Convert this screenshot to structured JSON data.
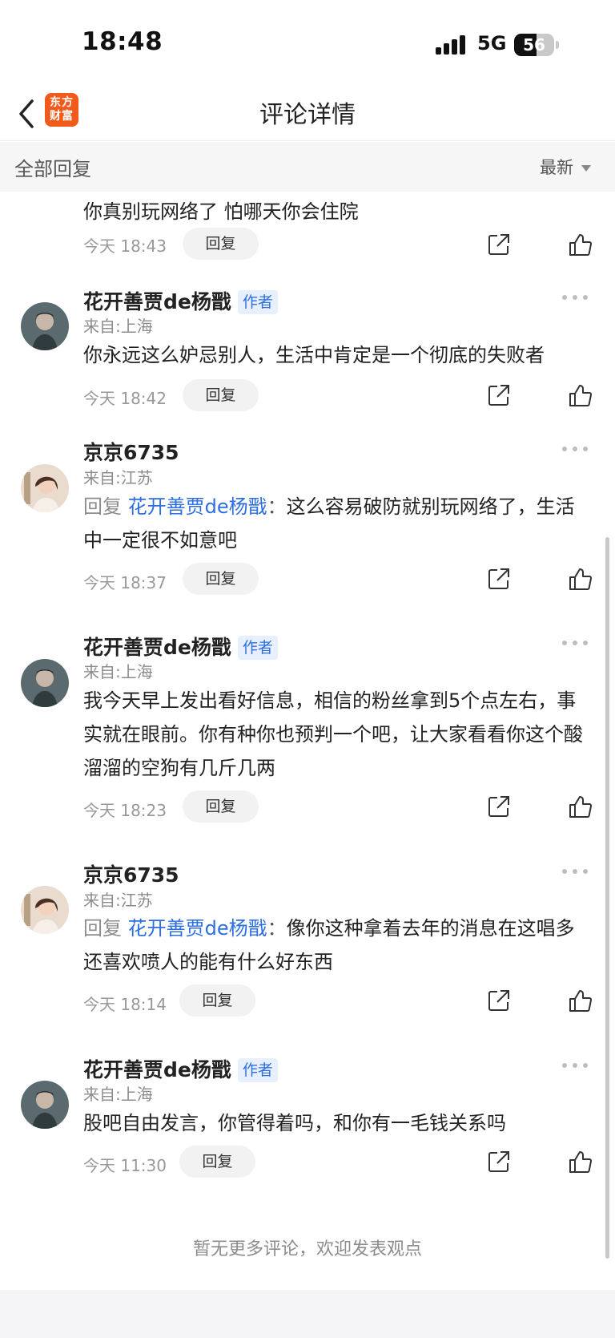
{
  "status_bar": {
    "time": "18:48",
    "network": "5G",
    "battery": "56",
    "battery_level": 0.56
  },
  "nav": {
    "logo_line1": "东方",
    "logo_line2": "财富",
    "title": "评论详情",
    "back_icon": "chevron-left-icon"
  },
  "section": {
    "title": "全部回复",
    "sort_label": "最新"
  },
  "reply_button_label": "回复",
  "reply_prefix": "回复",
  "reply_separator": "：",
  "author_badge": "作者",
  "partial_comment": {
    "text": "你真别玩网络了 怕哪天你会住院",
    "time": "今天 18:43"
  },
  "comments": [
    {
      "user": "花开善贾de杨戬",
      "is_author": true,
      "location": "来自:上海",
      "text": "你永远这么妒忌别人，生活中肯定是一个彻底的失败者",
      "time": "今天 18:42"
    },
    {
      "user": "京京6735",
      "is_author": false,
      "location": "来自:江苏",
      "reply_to": "花开善贾de杨戬",
      "text": "这么容易破防就别玩网络了，生活中一定很不如意吧",
      "time": "今天 18:37"
    },
    {
      "user": "花开善贾de杨戬",
      "is_author": true,
      "location": "来自:上海",
      "text": "我今天早上发出看好信息，相信的粉丝拿到5个点左右，事实就在眼前。你有种你也预判一个吧，让大家看看你这个酸溜溜的空狗有几斤几两",
      "time": "今天 18:23"
    },
    {
      "user": "京京6735",
      "is_author": false,
      "location": "来自:江苏",
      "reply_to": "花开善贾de杨戬",
      "text": "像你这种拿着去年的消息在这唱多还喜欢喷人的能有什么好东西",
      "time": "今天 18:14"
    },
    {
      "user": "花开善贾de杨戬",
      "is_author": true,
      "location": "来自:上海",
      "text": "股吧自由发言，你管得着吗，和你有一毛钱关系吗",
      "time": "今天 11:30"
    }
  ],
  "end_note": "暂无更多评论，欢迎发表观点",
  "icons": {
    "share": "share-icon",
    "like": "thumbs-up-icon",
    "more": "more-dots-icon"
  },
  "colors": {
    "accent_blue": "#2d6ee0",
    "logo_orange": "#f25a1c",
    "muted_text": "#8c8c8c"
  }
}
